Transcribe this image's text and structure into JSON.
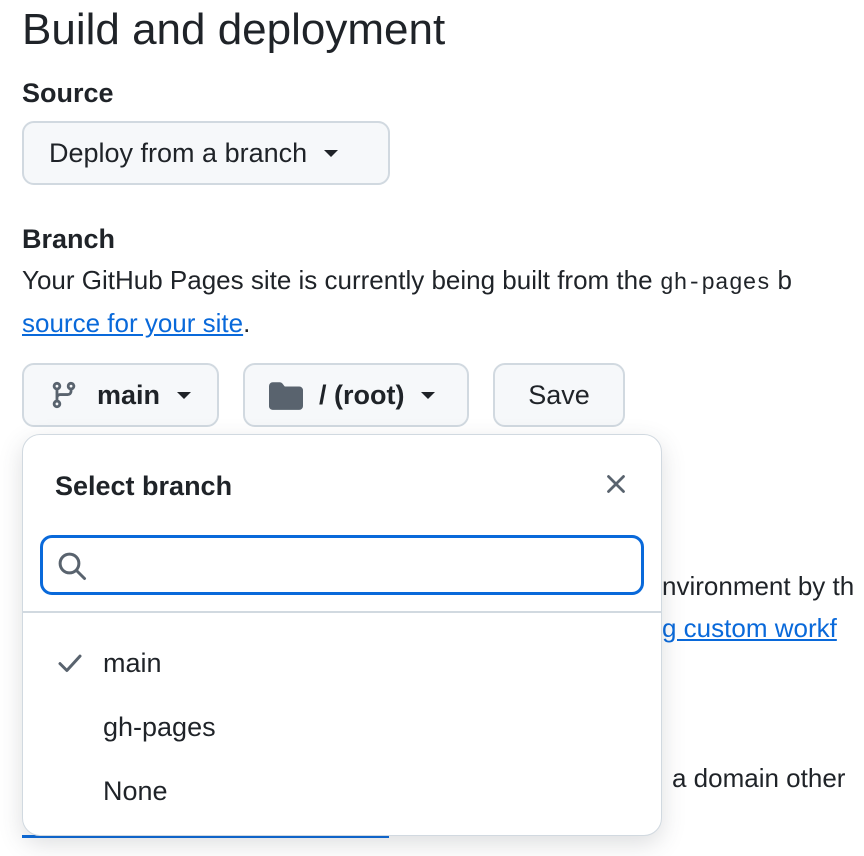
{
  "page": {
    "title": "Build and deployment",
    "source_label": "Source",
    "source_select": "Deploy from a branch",
    "branch_label": "Branch",
    "branch_desc_prefix": "Your GitHub Pages site is currently being built from the ",
    "branch_desc_code": "gh-pages",
    "branch_desc_suffix": " b",
    "branch_desc_link": "source for your site",
    "branch_desc_end": ".",
    "branch_button": "main",
    "folder_button": "/ (root)",
    "save_button": "Save",
    "bg_text_1": "nvironment by th",
    "bg_link_1": "g custom workf",
    "bg_text_2": "a domain other"
  },
  "popup": {
    "title": "Select branch",
    "search_value": "",
    "items": [
      {
        "label": "main",
        "selected": true
      },
      {
        "label": "gh-pages",
        "selected": false
      },
      {
        "label": "None",
        "selected": false
      }
    ]
  },
  "icons": [
    "caret-down-icon",
    "git-branch-icon",
    "folder-icon",
    "close-icon",
    "search-icon",
    "check-icon"
  ],
  "colors": {
    "accent": "#0969da",
    "button_bg": "#f6f8fa",
    "border": "#d1d9e0",
    "text": "#1f2328"
  }
}
